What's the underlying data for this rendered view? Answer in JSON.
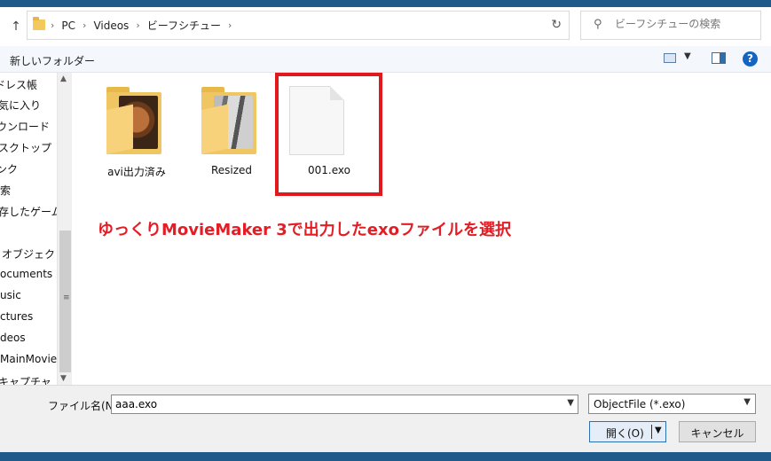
{
  "breadcrumb": [
    "PC",
    "Videos",
    "ビーフシチュー"
  ],
  "search": {
    "placeholder": "ビーフシチューの検索"
  },
  "toolbar": {
    "new_folder": "新しいフォルダー",
    "help": "?"
  },
  "nav": {
    "items": [
      "ドレス帳",
      "気に入り",
      "ウンロード",
      "スクトップ",
      "ンク",
      "索",
      "存したゲーム",
      "オブジェクト",
      "ocuments",
      "usic",
      "ctures",
      "deos",
      "MainMovie",
      "キャプチャ"
    ]
  },
  "files": [
    {
      "name": "avi出力済み",
      "type": "folder"
    },
    {
      "name": "Resized",
      "type": "folder"
    },
    {
      "name": "001.exo",
      "type": "file"
    }
  ],
  "annotation": "ゆっくりMovieMaker 3で出力したexoファイルを選択",
  "highlight_color": "#e0191e",
  "footer": {
    "filename_label": "ファイル名(N):",
    "filename_value": "aaa.exo",
    "filter_value": "ObjectFile (*.exo)",
    "open_label": "開く(O)",
    "cancel_label": "キャンセル"
  }
}
